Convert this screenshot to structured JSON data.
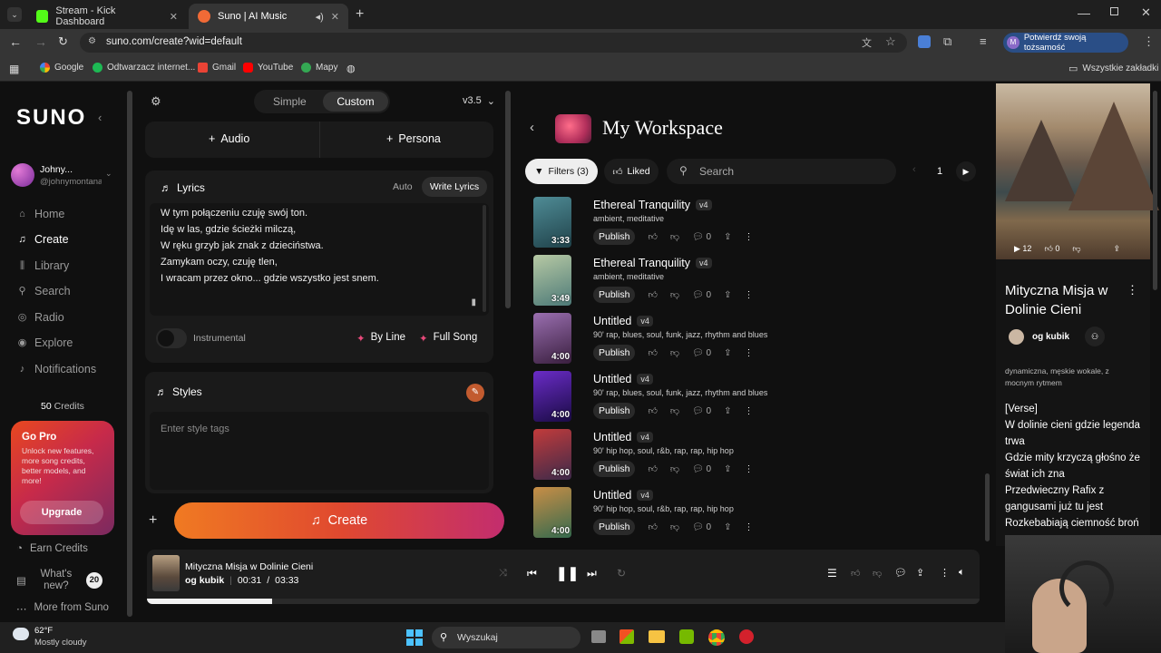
{
  "browser": {
    "tabs": [
      {
        "title": "Stream - Kick Dashboard",
        "color": "#53fc18"
      },
      {
        "title": "Suno | AI Music",
        "color": "#f06a36"
      }
    ],
    "url": "suno.com/create?wid=default",
    "profile_label": "Potwierdź swoją tożsamość",
    "bookmarks": [
      "Google",
      "Odtwarzacz internet...",
      "Gmail",
      "YouTube",
      "Mapy"
    ],
    "all_bookmarks": "Wszystkie zakładki"
  },
  "sidebar": {
    "logo": "SUNO",
    "user_name": "Johny...",
    "user_handle": "@johnymontana",
    "nav": [
      "Home",
      "Create",
      "Library",
      "Search",
      "Radio",
      "Explore",
      "Notifications"
    ],
    "credits": "50",
    "credits_label": "Credits",
    "gopro_title": "Go Pro",
    "gopro_text": "Unlock new features, more song credits, better models, and more!",
    "upgrade": "Upgrade",
    "earn": "Earn Credits",
    "whats_new": "What's new?",
    "whats_new_count": "20",
    "more": "More from Suno"
  },
  "creator": {
    "modes": [
      "Simple",
      "Custom"
    ],
    "version": "v3.5",
    "audio": "Audio",
    "persona": "Persona",
    "lyrics_label": "Lyrics",
    "auto": "Auto",
    "write": "Write Lyrics",
    "lyrics_lines": [
      "W tym połączeniu czuję swój ton.",
      "Idę w las, gdzie ścieżki milczą,",
      "W ręku grzyb jak znak z dzieciństwa.",
      "Zamykam oczy, czuję tlen,",
      "I wracam przez okno... gdzie wszystko jest snem."
    ],
    "instrumental": "Instrumental",
    "by_line": "By Line",
    "full_song": "Full Song",
    "styles_label": "Styles",
    "styles_placeholder": "Enter style tags",
    "create": "Create"
  },
  "workspace": {
    "title": "My Workspace",
    "filters": "Filters (3)",
    "liked": "Liked",
    "search_placeholder": "Search",
    "page": "1",
    "publish": "Publish",
    "songs": [
      {
        "title": "Ethereal Tranquility",
        "version": "v4",
        "tags": "ambient, meditative",
        "duration": "3:33",
        "comments": "0",
        "c1": "#4f8c96",
        "c2": "#20424a"
      },
      {
        "title": "Ethereal Tranquility",
        "version": "v4",
        "tags": "ambient, meditative",
        "duration": "3:49",
        "comments": "0",
        "c1": "#b7c9a4",
        "c2": "#4d7a78"
      },
      {
        "title": "Untitled",
        "version": "v4",
        "tags": "90' rap, blues, soul, funk, jazz, rhythm and blues",
        "duration": "4:00",
        "comments": "0",
        "c1": "#9a6fb0",
        "c2": "#3a1f3f"
      },
      {
        "title": "Untitled",
        "version": "v4",
        "tags": "90' rap, blues, soul, funk, jazz, rhythm and blues",
        "duration": "4:00",
        "comments": "0",
        "c1": "#6a2cc7",
        "c2": "#1a0b45"
      },
      {
        "title": "Untitled",
        "version": "v4",
        "tags": "90' hip hop, soul, r&b, rap, rap, hip hop",
        "duration": "4:00",
        "comments": "0",
        "c1": "#c23b3b",
        "c2": "#3d2a4a"
      },
      {
        "title": "Untitled",
        "version": "v4",
        "tags": "90' hip hop, soul, r&b, rap, rap, hip hop",
        "duration": "4:00",
        "comments": "0",
        "c1": "#c98e46",
        "c2": "#356a4e"
      }
    ]
  },
  "detail": {
    "plays": "12",
    "likes": "0",
    "title": "Mityczna Misja w Dolinie Cieni",
    "author": "og kubik",
    "style": "dynamiczna, męskie wokale, z mocnym rytmem",
    "lyrics": [
      "[Verse]",
      "W dolinie cieni gdzie legenda trwa",
      "Gdzie mity krzyczą głośno że świat ich zna",
      "Przedwieczny Rafix z gangusami już tu jest",
      "Rozkebabiają ciemność broń"
    ]
  },
  "player": {
    "title": "Mityczna Misja w Dolinie Cieni",
    "author": "og kubik",
    "current": "00:31",
    "total": "03:33",
    "progress": 0.15
  },
  "taskbar": {
    "temp": "62°F",
    "weather": "Mostly cloudy",
    "search": "Wyszukaj"
  }
}
